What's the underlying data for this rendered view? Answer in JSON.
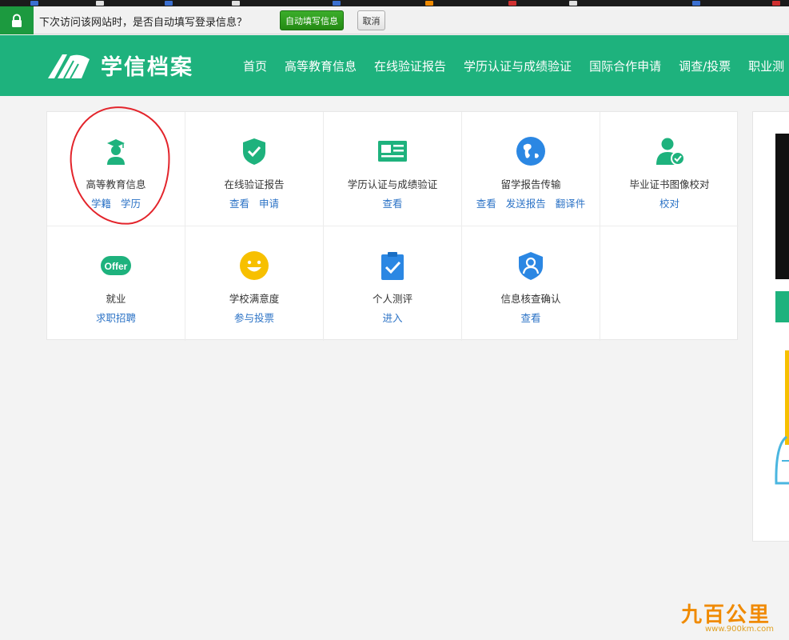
{
  "autofill_bar": {
    "prompt": "下次访问该网站时，是否自动填写登录信息？",
    "fill_button": "自动填写信息",
    "cancel_button": "取消"
  },
  "header": {
    "logo_text": "学信档案",
    "nav": [
      "首页",
      "高等教育信息",
      "在线验证报告",
      "学历认证与成绩验证",
      "国际合作申请",
      "调查/投票",
      "职业测"
    ]
  },
  "services": [
    {
      "name": "高等教育信息",
      "links": [
        "学籍",
        "学历"
      ],
      "icon": "graduate-cap-icon"
    },
    {
      "name": "在线验证报告",
      "links": [
        "查看",
        "申请"
      ],
      "icon": "shield-check-icon"
    },
    {
      "name": "学历认证与成绩验证",
      "links": [
        "查看"
      ],
      "icon": "id-card-icon"
    },
    {
      "name": "留学报告传输",
      "links": [
        "查看",
        "发送报告",
        "翻译件"
      ],
      "icon": "globe-icon"
    },
    {
      "name": "毕业证书图像校对",
      "links": [
        "校对"
      ],
      "icon": "user-check-icon"
    },
    {
      "name": "就业",
      "links": [
        "求职招聘"
      ],
      "icon": "offer-badge-icon",
      "badge": "Offer"
    },
    {
      "name": "学校满意度",
      "links": [
        "参与投票"
      ],
      "icon": "smiley-icon"
    },
    {
      "name": "个人测评",
      "links": [
        "进入"
      ],
      "icon": "clipboard-check-icon"
    },
    {
      "name": "信息核查确认",
      "links": [
        "查看"
      ],
      "icon": "user-shield-icon"
    }
  ],
  "watermark": {
    "title": "九百公里",
    "url": "www.900km.com"
  },
  "colors": {
    "brand_green": "#1eb27d",
    "link_blue": "#2c73c6",
    "annotation_red": "#e3242b"
  }
}
